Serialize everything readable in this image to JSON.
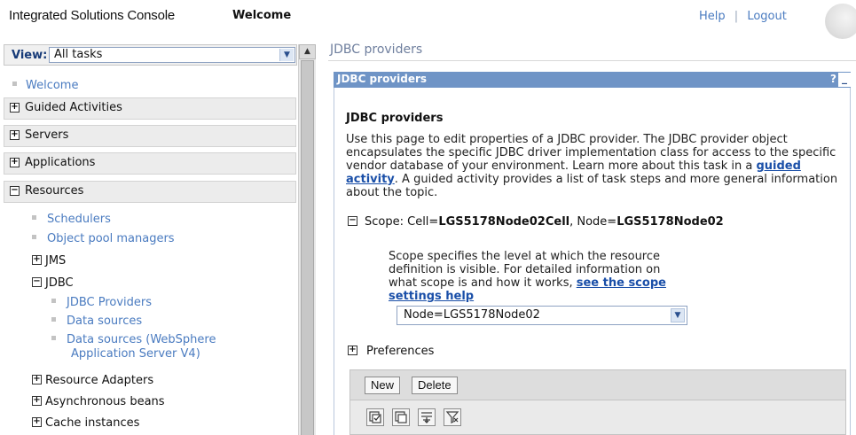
{
  "header": {
    "console_title": "Integrated Solutions Console",
    "welcome": "Welcome",
    "help": "Help",
    "separator": "|",
    "logout": "Logout"
  },
  "nav": {
    "view_label": "View:",
    "view_value": "All tasks",
    "welcome": "Welcome",
    "groups": {
      "guided": "Guided Activities",
      "servers": "Servers",
      "applications": "Applications",
      "resources": "Resources"
    },
    "resources_items": {
      "schedulers": "Schedulers",
      "object_pool": "Object pool managers",
      "jms": "JMS",
      "jdbc": "JDBC",
      "jdbc_providers": "JDBC Providers",
      "data_sources": "Data sources",
      "data_sources_ws_line1": "Data sources (WebSphere",
      "data_sources_ws_line2": "Application Server V4)",
      "resource_adapters": "Resource Adapters",
      "async_beans": "Asynchronous beans",
      "cache_instances": "Cache instances"
    },
    "plus": "+",
    "minus": "−"
  },
  "main": {
    "breadcrumb": "JDBC providers",
    "panel_title": "JDBC providers",
    "panel_help": "?",
    "panel_min": "_",
    "heading": "JDBC providers",
    "desc_part1": "Use this page to edit properties of a JDBC provider. The JDBC provider object encapsulates the specific JDBC driver implementation class for access to the specific vendor database of your environment. Learn more about this task in a ",
    "desc_link": "guided activity",
    "desc_part2": ". A guided activity provides a list of task steps and more general information about the topic.",
    "scope_prefix": "Scope: Cell=",
    "scope_cell": "LGS5178Node02Cell",
    "scope_mid": ", Node=",
    "scope_node": "LGS5178Node02",
    "scope_help_part1": "Scope specifies the level at which the resource definition is visible. For detailed information on what scope is and how it works, ",
    "scope_help_link": "see the scope settings help",
    "scope_select_value": "Node=LGS5178Node02",
    "preferences": "Preferences",
    "btn_new": "New",
    "btn_delete": "Delete"
  },
  "icons": {
    "select_all": "select-all-icon",
    "deselect_all": "deselect-all-icon",
    "show_filter": "show-filter-icon",
    "clear_filter": "clear-filter-icon"
  },
  "colors": {
    "panel_bar": "#6f94c6",
    "link": "#4a7bc0",
    "group_bg": "#ececec"
  }
}
